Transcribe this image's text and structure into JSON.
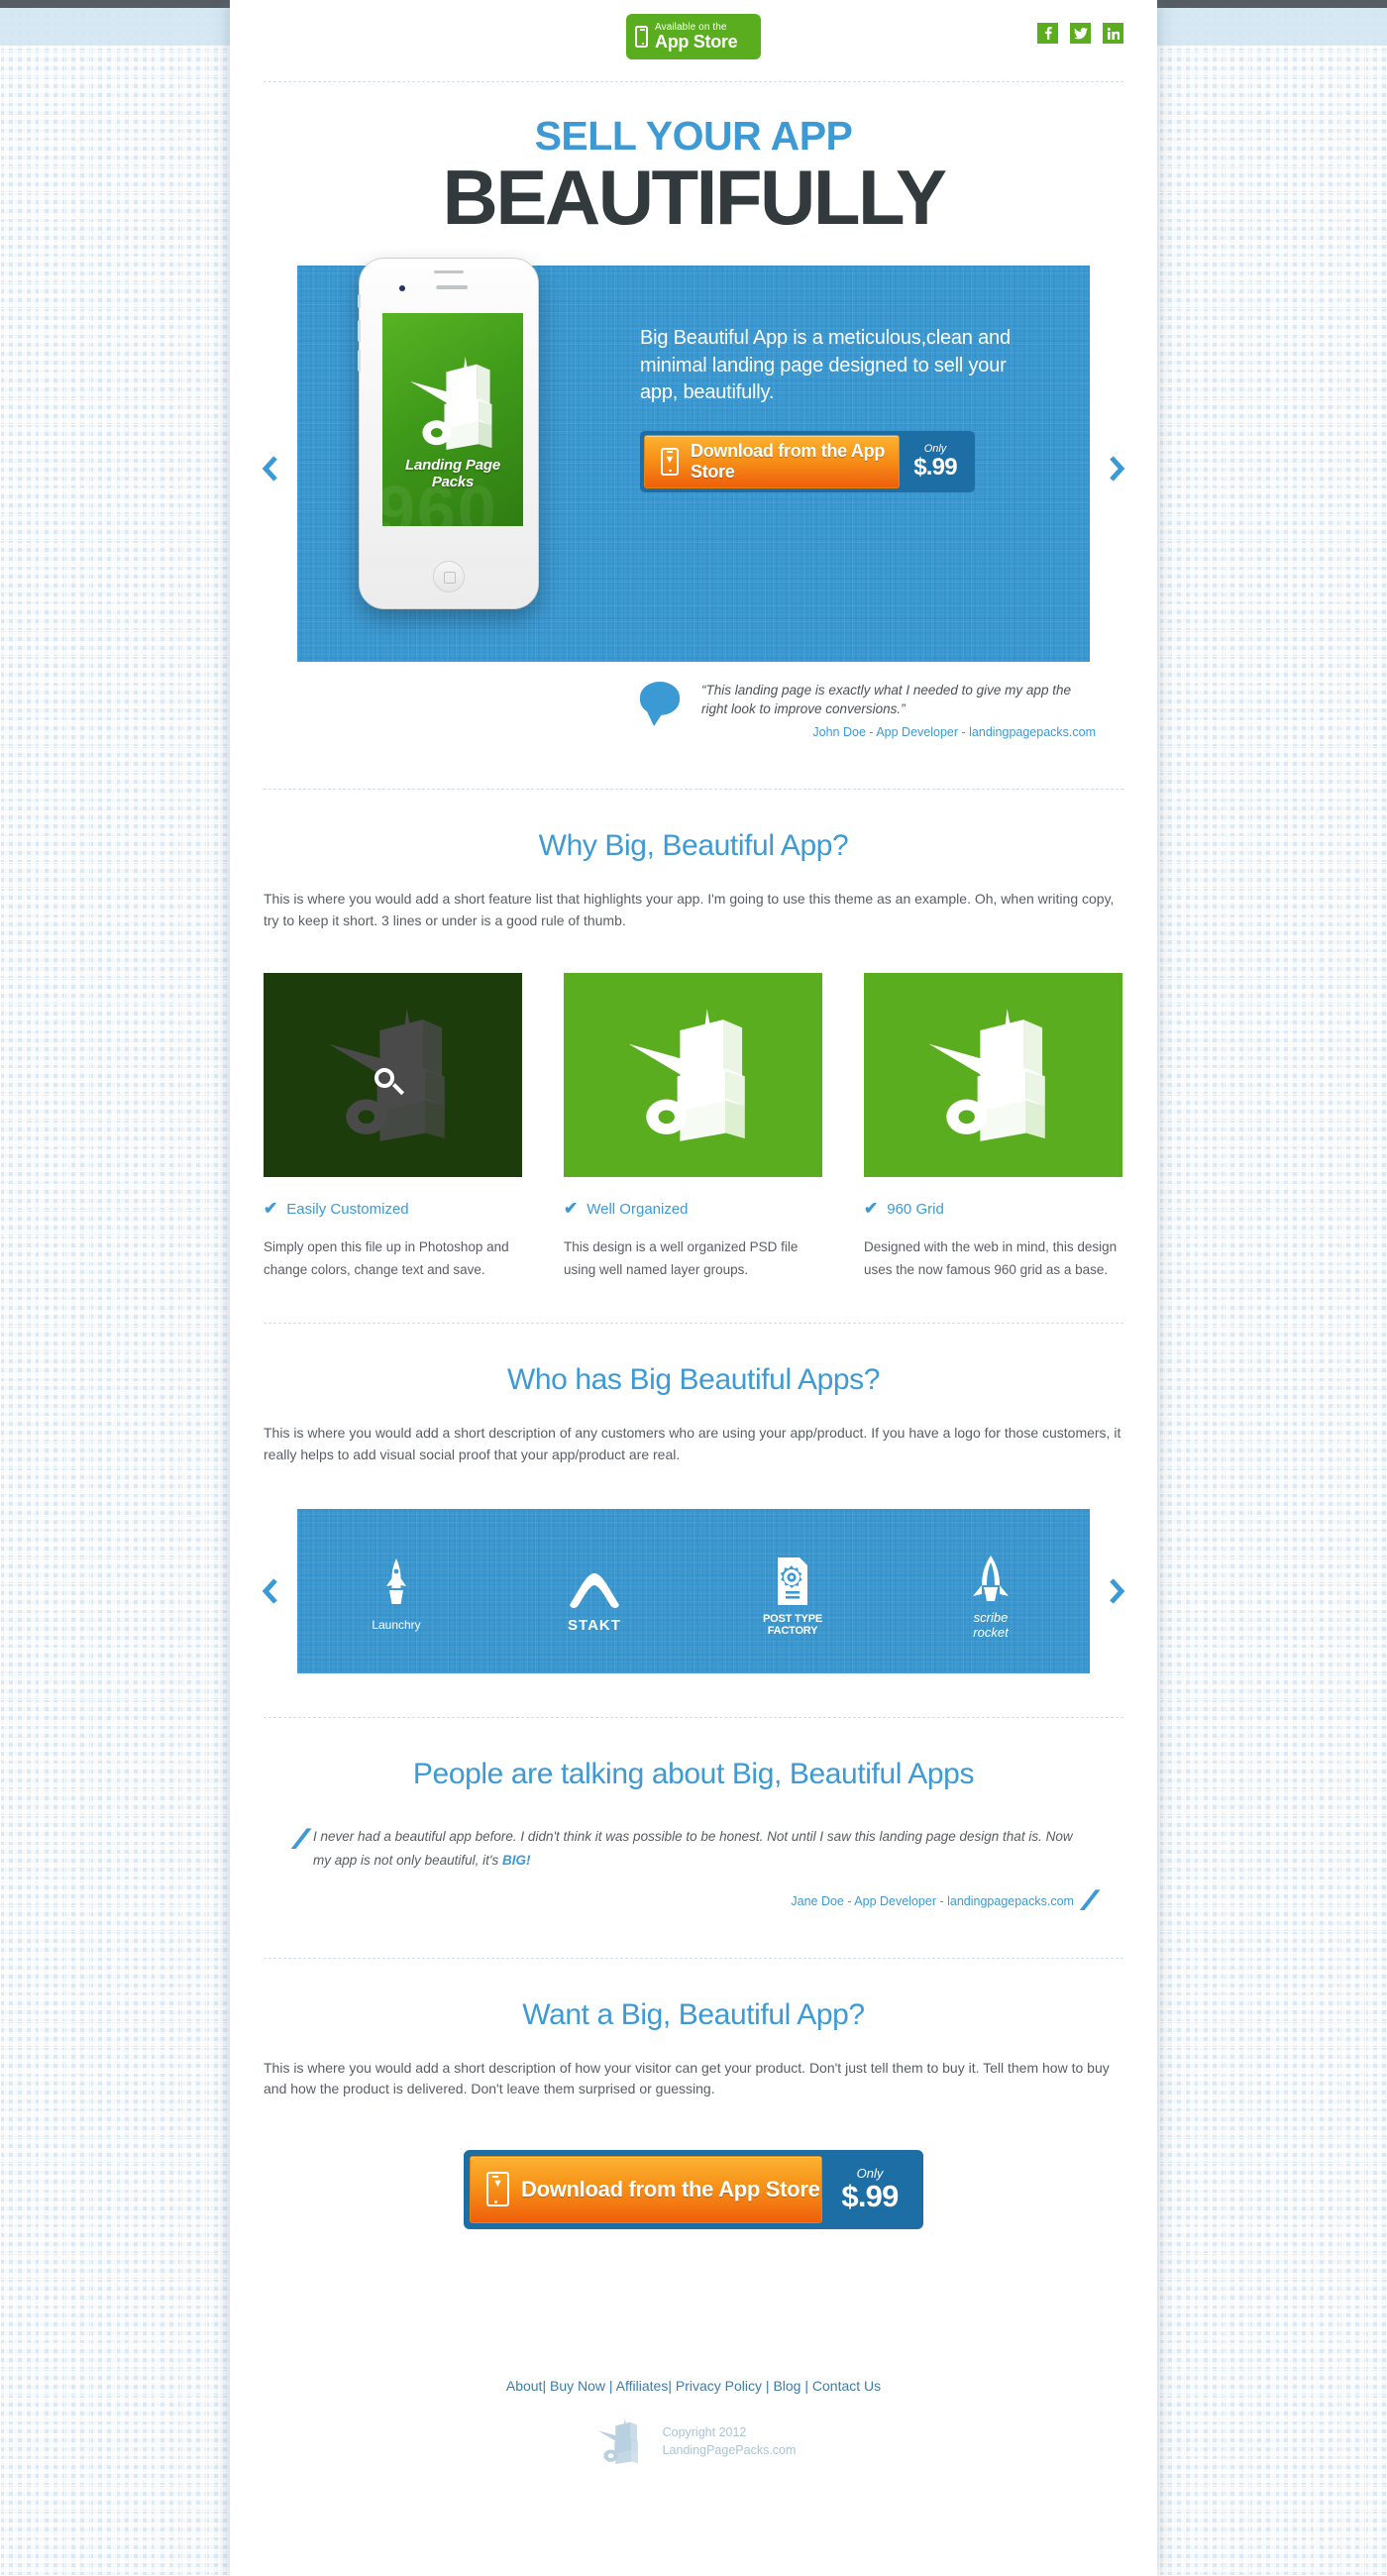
{
  "header": {
    "badge": {
      "line1": "Available on the",
      "line2": "App Store",
      "icon": "phone-icon"
    },
    "social": [
      {
        "name": "facebook-icon",
        "label": "f"
      },
      {
        "name": "twitter-icon",
        "label": "t"
      },
      {
        "name": "linkedin-icon",
        "label": "in"
      }
    ]
  },
  "hero": {
    "line1": "SELL YOUR APP",
    "line2": "BEAUTIFULLY",
    "phone_caption": "Landing Page Packs",
    "phone_ghost": "960",
    "description": "Big Beautiful App is a meticulous,clean and minimal landing page designed to sell your app, beautifully.",
    "cta": {
      "label": "Download from the App Store",
      "only": "Only",
      "price": "$.99",
      "icon": "phone-download-icon"
    },
    "quote": "“This landing page is exactly what I needed to give my app the right look to improve conversions.”",
    "quote_author": "John Doe - App Developer - landingpagepacks.com",
    "arrow_prev": "‹",
    "arrow_next": "›"
  },
  "why": {
    "title": "Why Big, Beautiful App?",
    "subtitle": "This is where you would add a short feature list that highlights your app. I'm going to use this theme as an example. Oh, when writing copy, try to keep it short. 3 lines or under is a good rule of thumb.",
    "features": [
      {
        "heading": "Easily Customized",
        "body": "Simply open this file up in Photoshop and change colors, change text and save.",
        "check": "✔",
        "state": "hover"
      },
      {
        "heading": "Well Organized",
        "body": "This design is a well organized PSD file using well named layer groups.",
        "check": "✔",
        "state": "normal"
      },
      {
        "heading": "960 Grid",
        "body": "Designed with the web in mind, this design uses the now famous 960 grid as a base.",
        "check": "✔",
        "state": "normal"
      }
    ]
  },
  "who": {
    "title": "Who has Big Beautiful Apps?",
    "subtitle": "This is where you would add a short description of any customers who are using your app/product. If you have a logo for those customers, it really helps to add visual social proof that your app/product are real.",
    "clients": [
      {
        "name": "Launchry",
        "icon": "rocket-icon",
        "style": "plain"
      },
      {
        "name": "STAKT",
        "icon": "chevron-logo-icon",
        "style": "bold"
      },
      {
        "name": "POST TYPE\nFACTORY",
        "icon": "gear-document-icon",
        "style": "cond"
      },
      {
        "name": "scribe\nrocket",
        "icon": "rocket-pen-icon",
        "style": "ital"
      }
    ]
  },
  "talking": {
    "title": "People are talking about Big, Beautiful Apps",
    "quote_part1": "I never had a beautiful app before. I didn't think it was possible to be honest. Not until I saw this landing page design that is. Now my app is not only beautiful, it's ",
    "quote_highlight": "BIG!",
    "author": "Jane Doe - App Developer - landingpagepacks.com",
    "open_quote": "∕∕",
    "close_quote": "∕∕"
  },
  "want": {
    "title": "Want a Big, Beautiful App?",
    "subtitle": "This is where you would add a short description of how your visitor can get your product. Don't just tell them to buy it. Tell them how to buy and how the product is delivered. Don't leave them surprised or guessing.",
    "cta": {
      "label": "Download from the App Store",
      "only": "Only",
      "price": "$.99",
      "icon": "phone-download-icon"
    }
  },
  "footer": {
    "links": [
      "About",
      "Buy Now",
      "Affiliates",
      "Privacy Policy",
      "Blog",
      "Contact Us"
    ],
    "separator": "|",
    "copyright_line1": "Copyright 2012",
    "copyright_line2": "LandingPagePacks.com",
    "logo": "cart-logo-icon"
  },
  "colors": {
    "accent_blue": "#3d9ad4",
    "panel_blue": "#3b9ad4",
    "deep_blue": "#1d6ea4",
    "green": "#5aad1e",
    "orange": "#f79219",
    "dark_text": "#333a3d"
  }
}
